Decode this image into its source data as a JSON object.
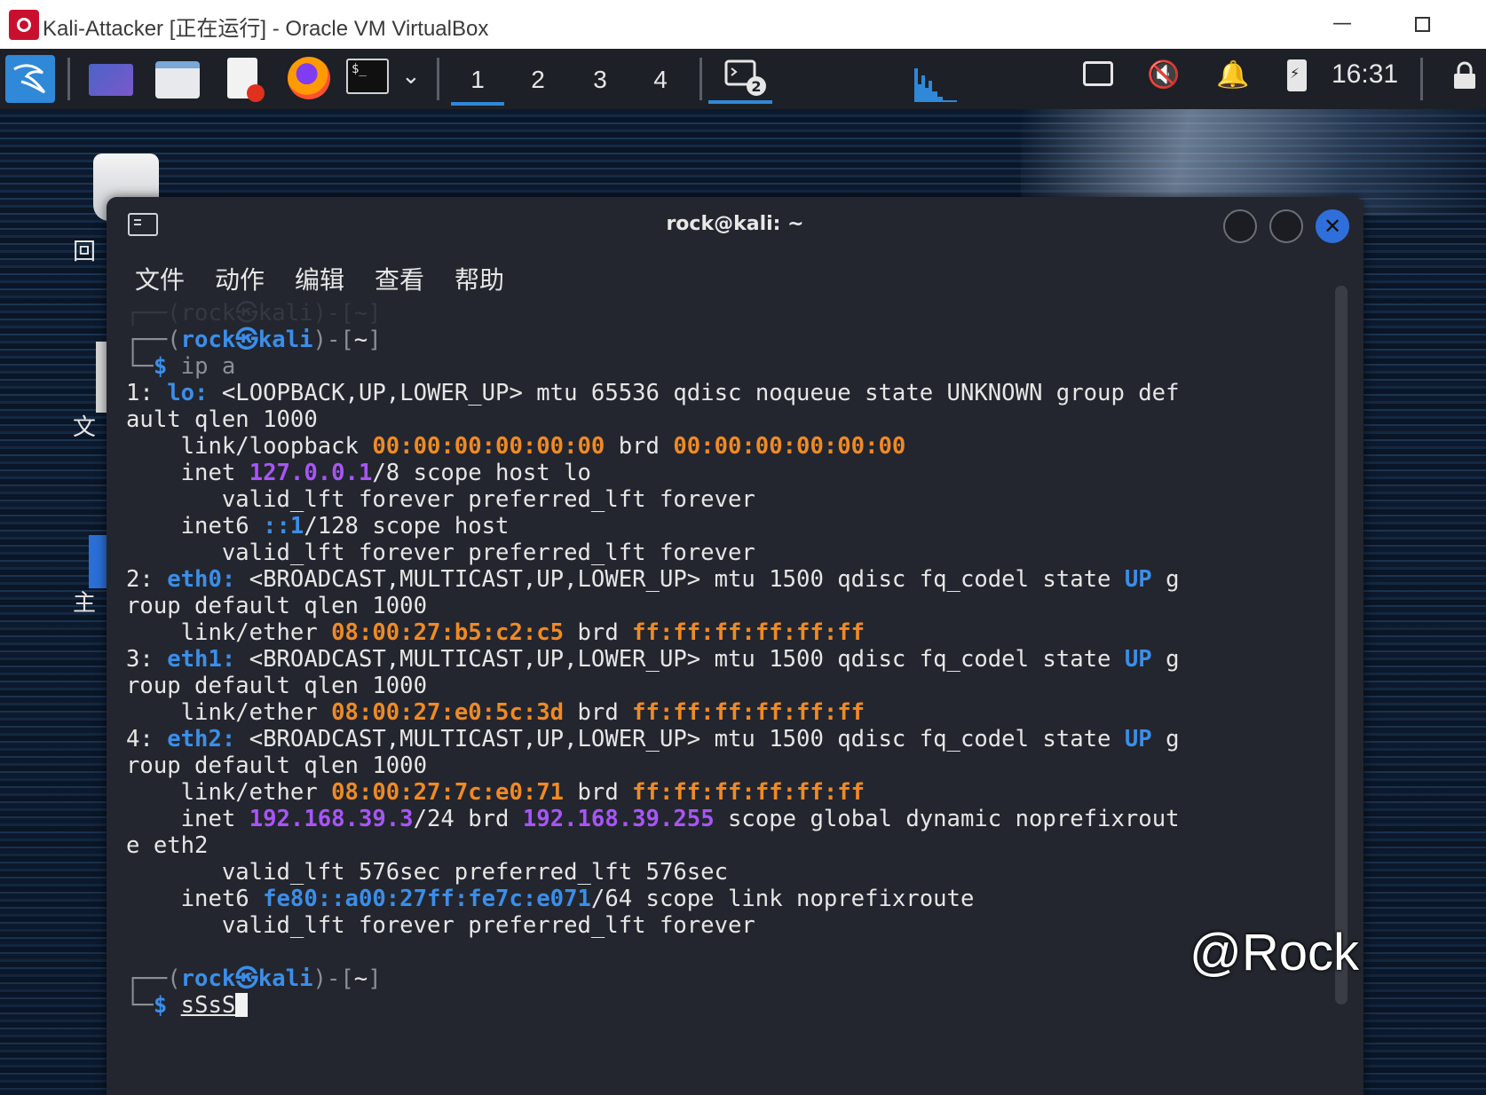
{
  "vbox": {
    "title": "Kali-Attacker [正在运行] - Oracle VM VirtualBox",
    "minimize": "—"
  },
  "panel": {
    "workspaces": [
      "1",
      "2",
      "3",
      "4"
    ],
    "active_workspace": "1",
    "task_badge": "2",
    "terminal_icon_text": "$_",
    "clock": "16:31",
    "icons": [
      "kali-menu-icon",
      "show-desktop-icon",
      "file-manager-icon",
      "text-editor-icon",
      "firefox-icon",
      "terminal-icon",
      "chevron-down-icon",
      "task-window-icon",
      "cpu-graph-icon",
      "network-icon",
      "mute-icon",
      "bell-icon",
      "battery-icon",
      "lock-icon"
    ]
  },
  "desktop": {
    "labels": [
      "回",
      "文",
      "主"
    ]
  },
  "terminal": {
    "title": "rock@kali: ~",
    "menu": [
      "文件",
      "动作",
      "编辑",
      "查看",
      "帮助"
    ],
    "faded_prompt": "┌──(rock㉿kali)-[~]",
    "prompt_open": "┌──(",
    "prompt_user": "rock",
    "prompt_at": "㉿",
    "prompt_host": "kali",
    "prompt_close": ")-[",
    "prompt_dir": "~",
    "prompt_end": "]",
    "prompt_line2": "└─",
    "prompt_dollar": "$",
    "command1": "ip a",
    "command2": "sSsS",
    "lines": {
      "l1_a": "1: ",
      "l1_b": "lo:",
      "l1_c": " <LOOPBACK,UP,LOWER_UP> mtu 65536 qdisc noqueue state UNKNOWN group def",
      "l2": "ault qlen 1000",
      "l3_a": "    link/loopback ",
      "l3_b": "00:00:00:00:00:00",
      "l3_c": " brd ",
      "l3_d": "00:00:00:00:00:00",
      "l4_a": "    inet ",
      "l4_b": "127.0.0.1",
      "l4_c": "/8 scope host lo",
      "l5": "       valid_lft forever preferred_lft forever",
      "l6_a": "    inet6 ",
      "l6_b": "::1",
      "l6_c": "/128 scope host",
      "l7": "       valid_lft forever preferred_lft forever",
      "l8_a": "2: ",
      "l8_b": "eth0:",
      "l8_c": " <BROADCAST,MULTICAST,UP,LOWER_UP> mtu 1500 qdisc fq_codel state ",
      "l8_d": "UP",
      "l8_e": " g",
      "l9": "roup default qlen 1000",
      "l10_a": "    link/ether ",
      "l10_b": "08:00:27:b5:c2:c5",
      "l10_c": " brd ",
      "l10_d": "ff:ff:ff:ff:ff:ff",
      "l11_a": "3: ",
      "l11_b": "eth1:",
      "l11_c": " <BROADCAST,MULTICAST,UP,LOWER_UP> mtu 1500 qdisc fq_codel state ",
      "l11_d": "UP",
      "l11_e": " g",
      "l12": "roup default qlen 1000",
      "l13_a": "    link/ether ",
      "l13_b": "08:00:27:e0:5c:3d",
      "l13_c": " brd ",
      "l13_d": "ff:ff:ff:ff:ff:ff",
      "l14_a": "4: ",
      "l14_b": "eth2:",
      "l14_c": " <BROADCAST,MULTICAST,UP,LOWER_UP> mtu 1500 qdisc fq_codel state ",
      "l14_d": "UP",
      "l14_e": " g",
      "l15": "roup default qlen 1000",
      "l16_a": "    link/ether ",
      "l16_b": "08:00:27:7c:e0:71",
      "l16_c": " brd ",
      "l16_d": "ff:ff:ff:ff:ff:ff",
      "l17_a": "    inet ",
      "l17_b": "192.168.39.3",
      "l17_c": "/24 brd ",
      "l17_d": "192.168.39.255",
      "l17_e": " scope global dynamic noprefixrout",
      "l18": "e eth2",
      "l19": "       valid_lft 576sec preferred_lft 576sec",
      "l20_a": "    inet6 ",
      "l20_b": "fe80::a00:27ff:fe7c:e071",
      "l20_c": "/64 scope link noprefixroute",
      "l21": "       valid_lft forever preferred_lft forever"
    }
  },
  "watermark": "@Rock",
  "colors": {
    "prompt_blue": "#3b8eea",
    "mac_orange": "#f08a24",
    "ip_purple": "#a855f7",
    "panel_bg": "#1d2026",
    "terminal_bg": "#23262e",
    "accent": "#2f88d8"
  }
}
